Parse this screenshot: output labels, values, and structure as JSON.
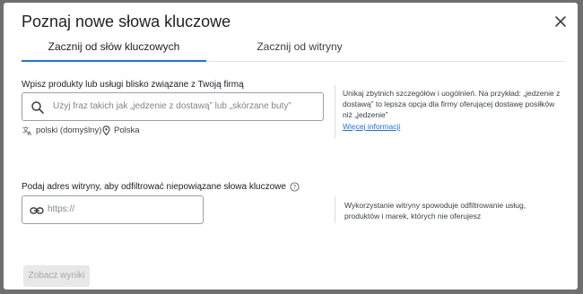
{
  "dialog": {
    "title": "Poznaj nowe słowa kluczowe"
  },
  "tabs": [
    {
      "label": "Zacznij od słów kluczowych",
      "active": true
    },
    {
      "label": "Zacznij od witryny",
      "active": false
    }
  ],
  "keywords_section": {
    "label": "Wpisz produkty lub usługi blisko związane z Twoją firmą",
    "placeholder": "Użyj fraz takich jak „jedzenie z dostawą” lub „skórzane buty”",
    "language": "polski (domyślny)",
    "location": "Polska",
    "hint": "Unikaj zbytnich szczegółów i uogólnień. Na przykład: „jedzenie z dostawą” to lepsza opcja dla firmy oferującej dostawę posiłków niż „jedzenie”",
    "more_link": "Więcej informacji"
  },
  "site_section": {
    "label": "Podaj adres witryny, aby odfiltrować niepowiązane słowa kluczowe",
    "placeholder": "https://",
    "hint": "Wykorzystanie witryny spowoduje odfiltrowanie usług, produktów i marek, których nie oferujesz"
  },
  "submit_button": {
    "label": "Zobacz wyniki",
    "enabled": false
  },
  "colors": {
    "accent": "#1a73e8",
    "backdrop": "#6f6f6f"
  },
  "icons": [
    "close-icon",
    "search-icon",
    "translate-icon",
    "location-pin-icon",
    "help-icon",
    "link-icon"
  ]
}
